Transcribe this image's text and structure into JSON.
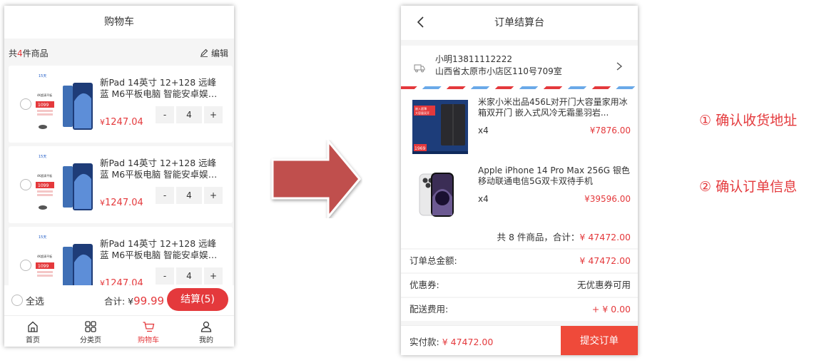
{
  "colors": {
    "accent": "#e4393c",
    "arrow": "#c0504d",
    "price": "#e4393c"
  },
  "cart": {
    "title": "购物车",
    "count_prefix": "共",
    "count": "4",
    "count_suffix": "件商品",
    "edit_label": "编辑",
    "items": [
      {
        "name": "新Pad 14英寸 12+128 远峰蓝 M6平板电脑 智能安卓娱乐十...",
        "price_symbol": "¥",
        "price": "1247.04",
        "qty": "4",
        "minus": "-",
        "plus": "+",
        "thumb_badge": "15天",
        "thumb_price": "1099"
      },
      {
        "name": "新Pad 14英寸 12+128 远峰蓝 M6平板电脑 智能安卓娱乐十...",
        "price_symbol": "¥",
        "price": "1247.04",
        "qty": "4",
        "minus": "-",
        "plus": "+",
        "thumb_badge": "15天",
        "thumb_price": "1099"
      },
      {
        "name": "新Pad 14英寸 12+128 远峰蓝 M6平板电脑 智能安卓娱乐十...",
        "price_symbol": "¥",
        "price": "1247.04",
        "qty": "4",
        "minus": "-",
        "plus": "+",
        "thumb_badge": "15天",
        "thumb_price": "1099"
      }
    ],
    "select_all": "全选",
    "total_label": "合计: ¥",
    "total_value": "99.99",
    "checkout_label": "结算(5)",
    "tabs": [
      {
        "label": "首页",
        "icon": "home-icon"
      },
      {
        "label": "分类页",
        "icon": "grid-icon"
      },
      {
        "label": "购物车",
        "icon": "cart-icon"
      },
      {
        "label": "我的",
        "icon": "user-icon"
      }
    ]
  },
  "checkout": {
    "title": "订单结算台",
    "address_line1": "小明13811112222",
    "address_line2": "山西省太原市小店区110号709室",
    "products": [
      {
        "name": "米家小米出品456L对开门大容量家用冰箱双开门 嵌入式风冷无霜墨羽岩...",
        "qty": "x4",
        "price": "¥7876.00",
        "thumb_text": "1969"
      },
      {
        "name": "Apple iPhone 14 Pro Max 256G 银色 移动联通电信5G双卡双待手机",
        "qty": "x4",
        "price": "¥39596.00"
      }
    ],
    "summary_prefix": "共 8 件商品，合计：",
    "summary_value": "¥ 47472.00",
    "rows": [
      {
        "key": "订单总金额:",
        "value": "¥ 47472.00"
      },
      {
        "key": "优惠券:",
        "value": "无优惠券可用"
      },
      {
        "key": "配送费用:",
        "value": "+ ¥ 0.00"
      }
    ],
    "pay_label": "实付款:",
    "pay_value": "¥ 47472.00",
    "submit_label": "提交订单"
  },
  "notes": [
    "① 确认收货地址",
    "② 确认订单信息"
  ]
}
